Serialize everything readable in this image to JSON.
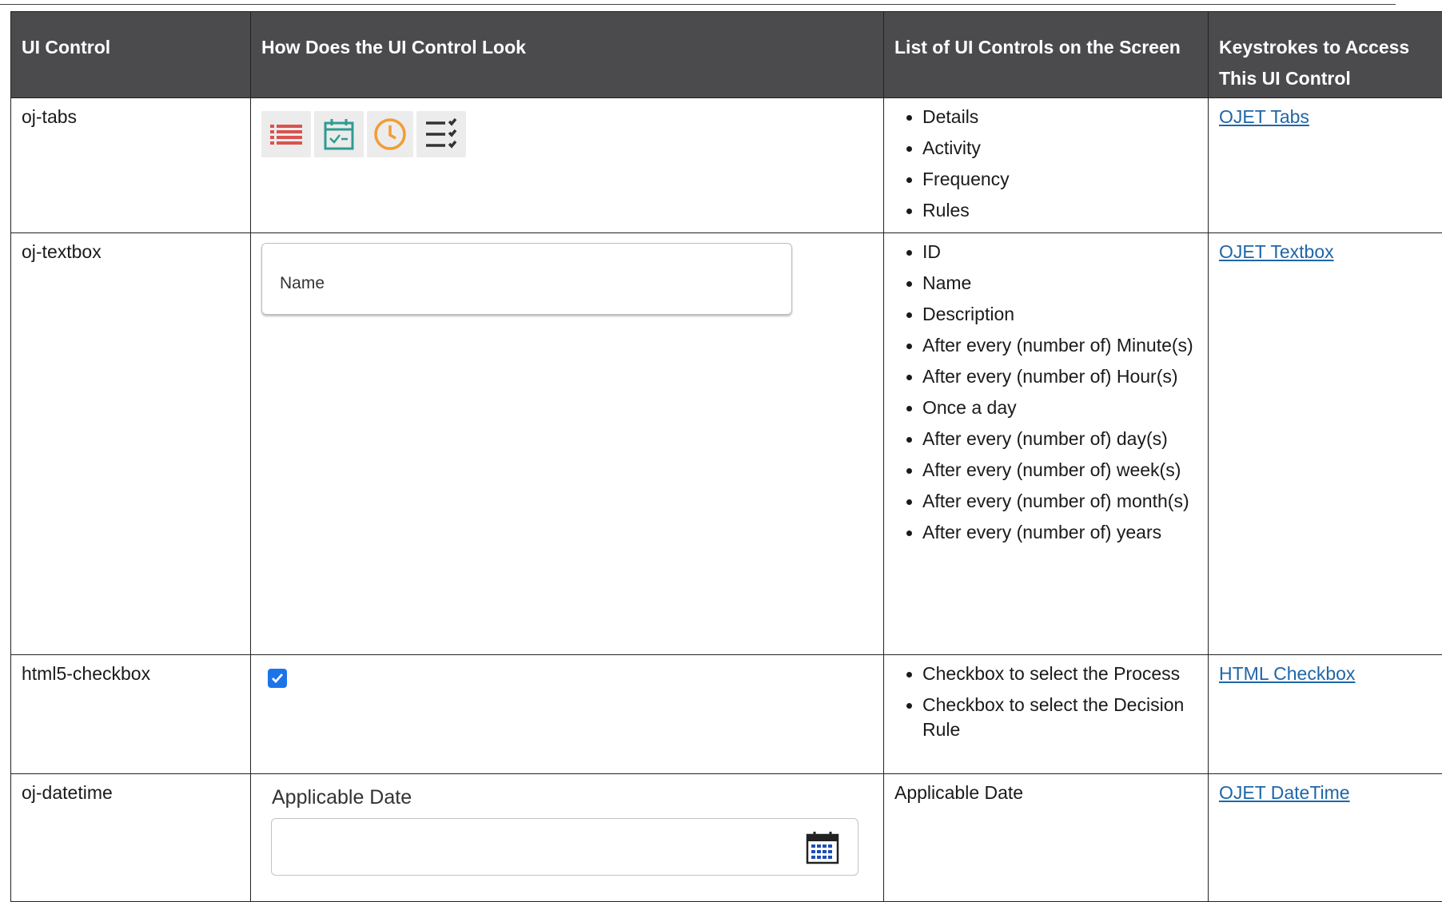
{
  "headers": {
    "ui_control": "UI Control",
    "look": "How Does the UI Control Look",
    "list": "List of UI Controls on the Screen",
    "keys": "Keystrokes to Access This UI Control"
  },
  "rows": [
    {
      "control": "oj-tabs",
      "items": [
        "Details",
        "Activity",
        "Frequency",
        "Rules"
      ],
      "link": "OJET Tabs"
    },
    {
      "control": "oj-textbox",
      "textbox_label": "Name",
      "items": [
        "ID",
        "Name",
        "Description",
        "After every (number of) Minute(s)",
        "After every (number of) Hour(s)",
        "Once a day",
        "After every (number of) day(s)",
        "After every (number of) week(s)",
        "After every (number of) month(s)",
        "After every (number of) years"
      ],
      "link": "OJET Textbox"
    },
    {
      "control": "html5-checkbox",
      "items": [
        "Checkbox to select the Process",
        "Checkbox to select the Decision Rule"
      ],
      "link": "HTML Checkbox"
    },
    {
      "control": "oj-datetime",
      "date_label": "Applicable Date",
      "list_text": "Applicable Date",
      "link": "OJET DateTime"
    }
  ],
  "icons": {
    "tab_icons": [
      "list-icon",
      "calendar-check-icon",
      "clock-icon",
      "checklist-icon"
    ],
    "checkbox": "checkbox-checked-icon",
    "calendar": "calendar-icon"
  },
  "colors": {
    "header_bg": "#4b4b4d",
    "link": "#1f66a8",
    "checkbox": "#1c74e9",
    "list_icon": "#d9534f",
    "calendar_check_icon": "#2e9c8f",
    "clock_icon": "#f39c33"
  }
}
